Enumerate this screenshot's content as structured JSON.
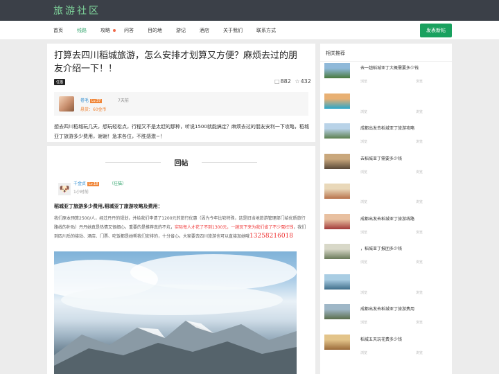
{
  "header": {
    "logo": "旅游社区"
  },
  "nav": {
    "items": [
      "首页",
      "线路",
      "攻略",
      "问答",
      "目的地",
      "游记",
      "酒店",
      "关于我们",
      "联系方式"
    ],
    "active_index": 1,
    "post_button": "发表新帖"
  },
  "question": {
    "title": "打算去四川稻城旅游，怎么安排才划算又方便？麻烦去过的朋友介绍一下！！",
    "tag": "任猫",
    "views": "882",
    "stars": "432",
    "author": {
      "name": "卷毛",
      "level": "Lv.37",
      "time": "7天前",
      "reward": "悬赏：60金币"
    },
    "body": "想去四川稻城玩几天，想玩轻松点，行程又不是太赶的那种，听说1500就能搞定？麻烦去过的朋友安利一下攻略，稻城亚丁旅游多少费用，谢谢！急求各位，不胜感激~！"
  },
  "reply": {
    "section_title": "回帖",
    "author": {
      "name": "千金贞",
      "level": "Lv.18",
      "tag": "（任猫）",
      "time": "1小时前"
    },
    "heading": "稻城亚丁旅游多少费用,稻城亚丁旅游攻略及费用：",
    "body_a": "我们原本预算2500/人，经过丹丹的规划，并给我们申请了1200元的旅行优惠（因为今年比较特殊，这是旧当地旅游管理部门给优质旅行路线的补贴）丹丹她真是热情又很细心，重要的是推荐真的不坑，",
    "body_red": "实际每人才花了不到1300元，一趟玩下来为我们省了不少冤枉钱",
    "body_b": "，我们到四川后的接站、酒店、门票、吃饭都是她帮我们安排的，十分省心。大家要去四川旅游也可以直接加她哦",
    "phone": "13258216018"
  },
  "sidebar": {
    "title": "相关推荐",
    "items": [
      {
        "title": "去一趟稻城亚丁大概需要多少钱",
        "meta_a": "浏览",
        "meta_b": "浏览",
        "colors": [
          "#4a7a3d",
          "#8fb9d9"
        ]
      },
      {
        "title": "",
        "meta_a": "浏览",
        "meta_b": "浏览",
        "colors": [
          "#2aa6c9",
          "#e8b073"
        ]
      },
      {
        "title": "成都出发去稻城亚丁旅游攻略",
        "meta_a": "浏览",
        "meta_b": "浏览",
        "colors": [
          "#5c7f4e",
          "#b9d3e8"
        ]
      },
      {
        "title": "去稻城亚丁需要多少钱",
        "meta_a": "浏览",
        "meta_b": "浏览",
        "colors": [
          "#5a4a3a",
          "#c9a77c"
        ]
      },
      {
        "title": "",
        "meta_a": "浏览",
        "meta_b": "浏览",
        "colors": [
          "#b8734c",
          "#e9d8b9"
        ]
      },
      {
        "title": "成都出发去稻城亚丁旅游线路",
        "meta_a": "浏览",
        "meta_b": "浏览",
        "colors": [
          "#a23a3a",
          "#e8c0a0"
        ]
      },
      {
        "title": "，稻城亚丁报团多少钱",
        "meta_a": "浏览",
        "meta_b": "浏览",
        "colors": [
          "#6a7a5a",
          "#d8d8c8"
        ]
      },
      {
        "title": "",
        "meta_a": "浏览",
        "meta_b": "浏览",
        "colors": [
          "#3f6e8a",
          "#a9cde3"
        ]
      },
      {
        "title": "成都出发去稻城亚丁旅游费用",
        "meta_a": "浏览",
        "meta_b": "浏览",
        "colors": [
          "#5b6e4b",
          "#9fb7c7"
        ]
      },
      {
        "title": "稻城五天玩花费多少钱",
        "meta_a": "浏览",
        "meta_b": "浏览",
        "colors": [
          "#9a6a3a",
          "#e3c48a"
        ]
      }
    ]
  }
}
